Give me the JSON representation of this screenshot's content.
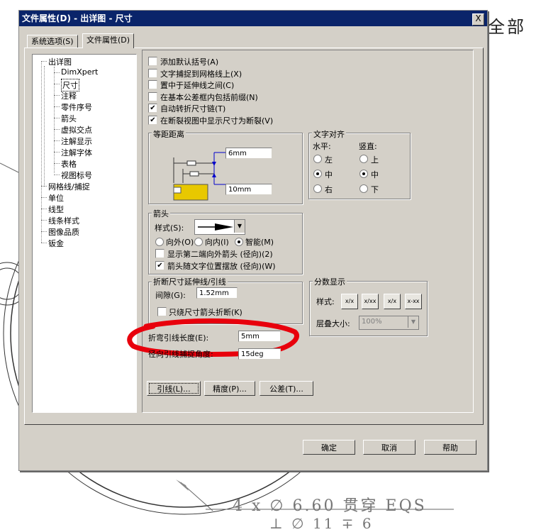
{
  "dialog": {
    "title": "文件属性(D) - 出详图 - 尺寸",
    "close_glyph": "X"
  },
  "tabs": [
    {
      "label": "系统选项(S)",
      "active": false
    },
    {
      "label": "文件属性(D)",
      "active": true
    }
  ],
  "tree": {
    "items": [
      {
        "label": "出详图",
        "level": 0
      },
      {
        "label": "DimXpert",
        "level": 1
      },
      {
        "label": "尺寸",
        "level": 1,
        "selected": true
      },
      {
        "label": "注释",
        "level": 1
      },
      {
        "label": "零件序号",
        "level": 1
      },
      {
        "label": "箭头",
        "level": 1
      },
      {
        "label": "虚拟交点",
        "level": 1
      },
      {
        "label": "注解显示",
        "level": 1
      },
      {
        "label": "注解字体",
        "level": 1
      },
      {
        "label": "表格",
        "level": 1
      },
      {
        "label": "视图标号",
        "level": 1
      },
      {
        "label": "网格线/捕捉",
        "level": 0
      },
      {
        "label": "单位",
        "level": 0
      },
      {
        "label": "线型",
        "level": 0
      },
      {
        "label": "线条样式",
        "level": 0
      },
      {
        "label": "图像品质",
        "level": 0
      },
      {
        "label": "钣金",
        "level": 0
      }
    ]
  },
  "options": {
    "checkboxes": [
      {
        "label": "添加默认括号(A)",
        "checked": false
      },
      {
        "label": "文字捕捉到网格线上(X)",
        "checked": false
      },
      {
        "label": "置中于延伸线之间(C)",
        "checked": false
      },
      {
        "label": "在基本公差框内包括前缀(N)",
        "checked": false
      },
      {
        "label": "自动转折尺寸链(T)",
        "checked": true
      },
      {
        "label": "在断裂视图中显示尺寸为断裂(V)",
        "checked": true
      }
    ]
  },
  "offset_distance": {
    "title": "等距距离",
    "value1": "6mm",
    "value2": "10mm"
  },
  "text_align": {
    "title": "文字对齐",
    "horizontal_label": "水平:",
    "vertical_label": "竖直:",
    "horizontal": [
      {
        "label": "左",
        "selected": false
      },
      {
        "label": "中",
        "selected": true
      },
      {
        "label": "右",
        "selected": false
      }
    ],
    "vertical": [
      {
        "label": "上",
        "selected": false
      },
      {
        "label": "中",
        "selected": true
      },
      {
        "label": "下",
        "selected": false
      }
    ]
  },
  "arrows": {
    "title": "箭头",
    "style_label": "样式(S):",
    "radios": [
      {
        "label": "向外(O)",
        "selected": false
      },
      {
        "label": "向内(I)",
        "selected": false
      },
      {
        "label": "智能(M)",
        "selected": true
      }
    ],
    "cb_second_outward": {
      "label": "显示第二端向外箭头 (径向)(2)",
      "checked": false
    },
    "cb_follow_text": {
      "label": "箭头随文字位置摆放 (径向)(W)",
      "checked": true
    }
  },
  "break_lines": {
    "title": "折断尺寸延伸线/引线",
    "gap_label": "间隙(G):",
    "gap_value": "1.52mm",
    "cb_arrow_only": {
      "label": "只绕尺寸箭头折断(K)",
      "checked": false
    }
  },
  "fraction_display": {
    "title": "分数显示",
    "style_label": "样式:",
    "stack_label": "层叠大小:",
    "stack_value": "100%",
    "styles": [
      "x/x",
      "x/xx",
      "x/x",
      "x-xx"
    ]
  },
  "bent_leader": {
    "label": "折弯引线长度(E):",
    "value": "5mm"
  },
  "radial_snap": {
    "label": "径向引线捕捉角度:",
    "value": "15deg"
  },
  "bottom_buttons": [
    {
      "label": "引线(L)..."
    },
    {
      "label": "精度(P)..."
    },
    {
      "label": "公差(T)..."
    }
  ],
  "footer_buttons": [
    {
      "label": "确定"
    },
    {
      "label": "取消"
    },
    {
      "label": "帮助"
    }
  ],
  "background": {
    "corner_text": "全部",
    "bottom_text1": "4 x ∅ 6.60 贯穿 EQS",
    "bottom_text2": "⊥ ∅ 11 ∓ 6"
  },
  "colors": {
    "annotation_red": "#e8000c",
    "title_bar": "#0a246a",
    "dialog_bg": "#d4d0c8"
  }
}
